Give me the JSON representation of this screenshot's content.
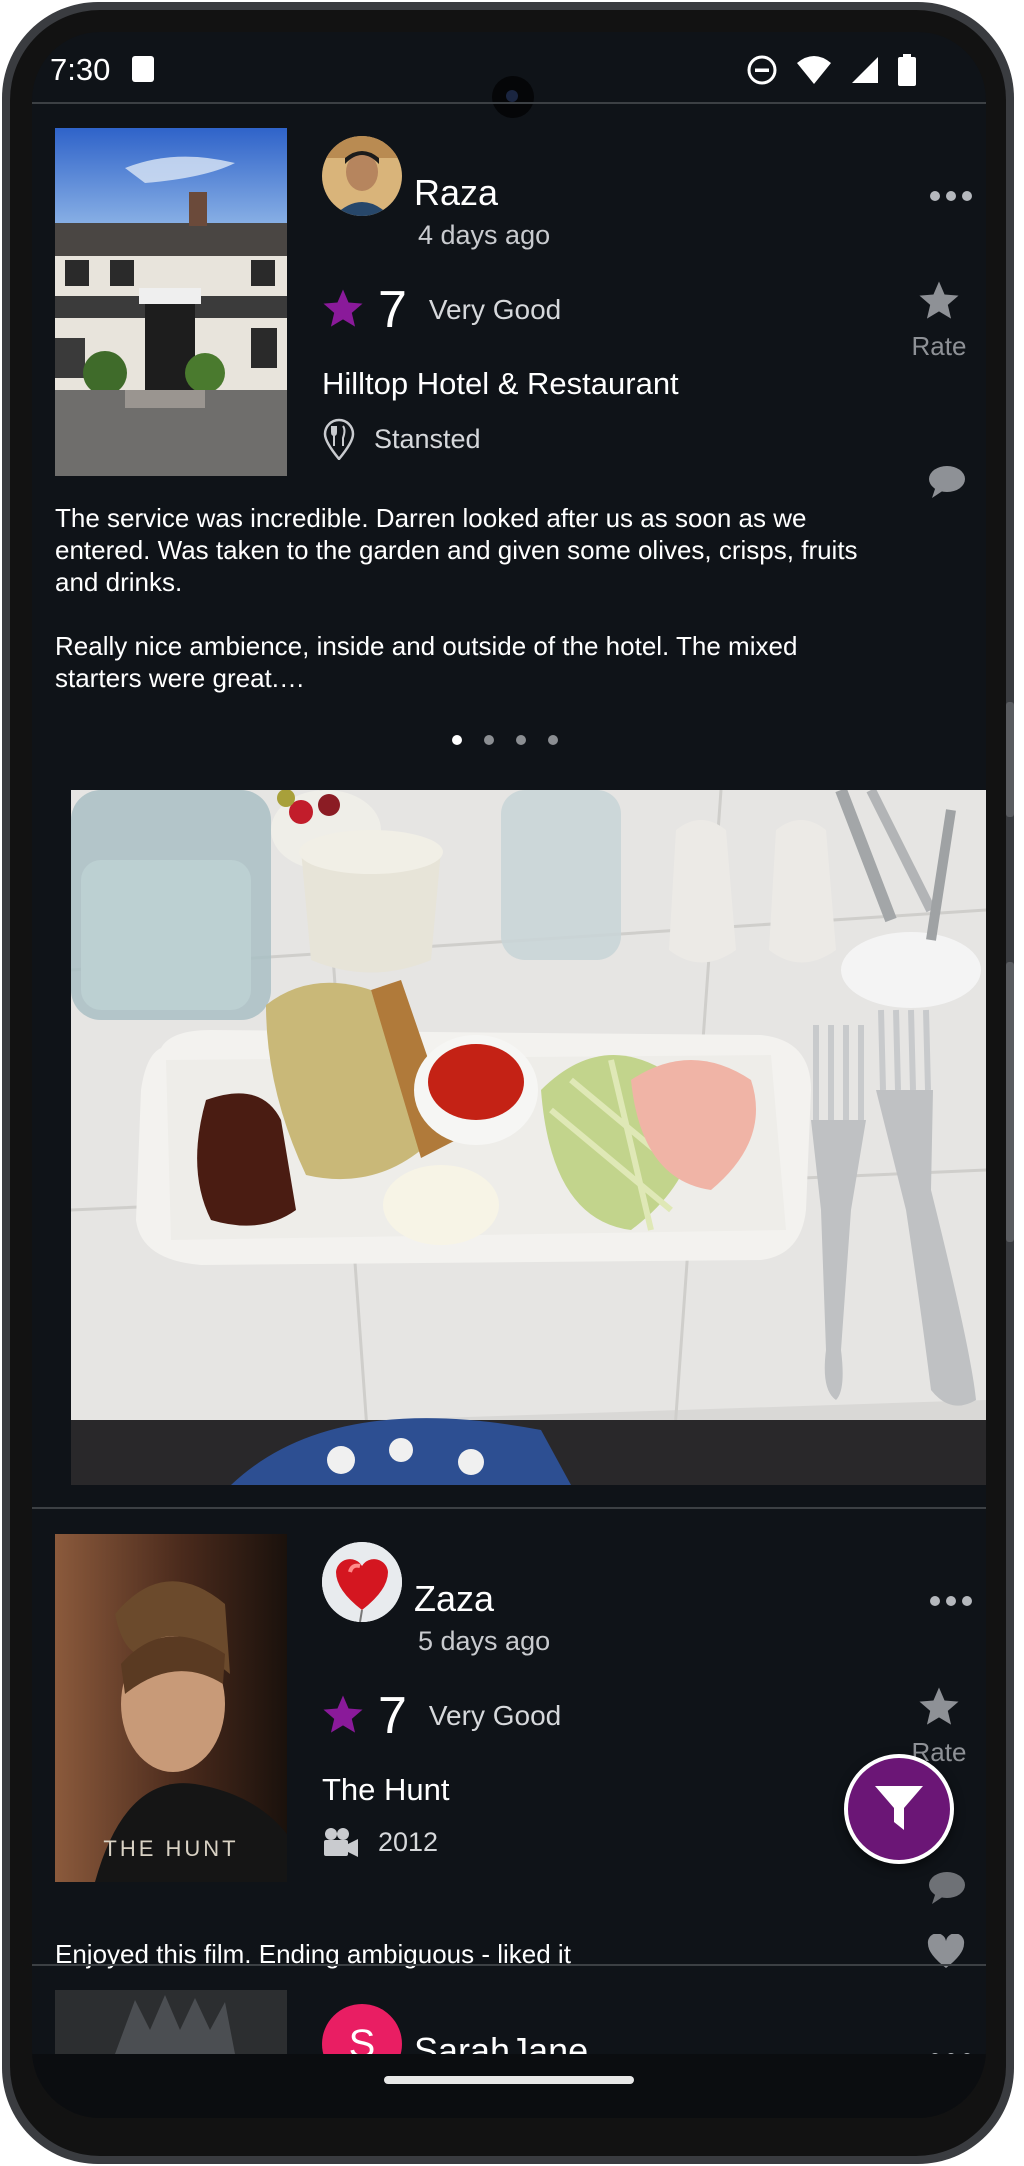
{
  "status_bar": {
    "time": "7:30"
  },
  "feed": [
    {
      "username": "Raza",
      "time_ago": "4 days ago",
      "score": "7",
      "rating_label": "Very Good",
      "title": "Hilltop Hotel & Restaurant",
      "meta": "Stansted",
      "meta_icon": "restaurant-pin-icon",
      "rate_label": "Rate",
      "review": "The service was incredible. Darren looked after us as soon as we entered. Was taken to the garden and given some olives, crisps, fruits and drinks.\n\nReally nice ambience, inside and outside of the hotel. The mixed starters were great.…",
      "carousel": {
        "count": 4,
        "active": 0
      }
    },
    {
      "username": "Zaza",
      "time_ago": "5 days ago",
      "score": "7",
      "rating_label": "Very Good",
      "title": "The Hunt",
      "meta": "2012",
      "meta_icon": "movie-camera-icon",
      "rate_label": "Rate",
      "poster_text": "THE HUNT",
      "review": "Enjoyed this film. Ending ambiguous - liked it"
    },
    {
      "username": "SarahJane",
      "avatar_initial": "S"
    }
  ],
  "colors": {
    "background": "#0f1318",
    "star": "#8a1a9a",
    "fab": "#6b1676",
    "avatar_pink": "#e91e63"
  }
}
